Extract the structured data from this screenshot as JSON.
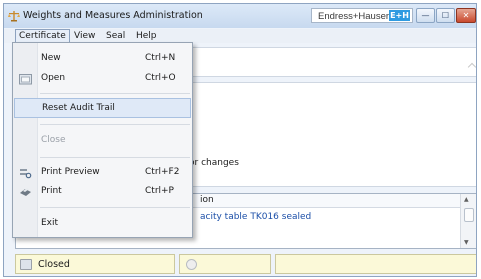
{
  "window": {
    "title": "Weights and Measures Administration",
    "brand": "Endress+Hauser",
    "brand_logo": "E+H"
  },
  "controls": {
    "minimize": "—",
    "maximize": "☐",
    "close": "✕"
  },
  "menubar": {
    "certificate": "Certificate",
    "view": "View",
    "seal": "Seal",
    "help": "Help"
  },
  "certificate_menu": {
    "new": {
      "label": "New",
      "shortcut": "Ctrl+N"
    },
    "open": {
      "label": "Open",
      "shortcut": "Ctrl+O"
    },
    "reset": {
      "label": "Reset Audit Trail"
    },
    "close": {
      "label": "Close"
    },
    "print_preview": {
      "label": "Print Preview",
      "shortcut": "Ctrl+F2"
    },
    "print": {
      "label": "Print",
      "shortcut": "Ctrl+P"
    },
    "exit": {
      "label": "Exit"
    }
  },
  "content": {
    "partial_text": "ajor changes"
  },
  "grid": {
    "column_header": "ion",
    "row_text": "acity table TK016 sealed"
  },
  "status": {
    "state": "Closed"
  },
  "colors": {
    "accent": "#2f9be1",
    "status_bg": "#fbf9d8",
    "link_text": "#1c4fa8"
  }
}
